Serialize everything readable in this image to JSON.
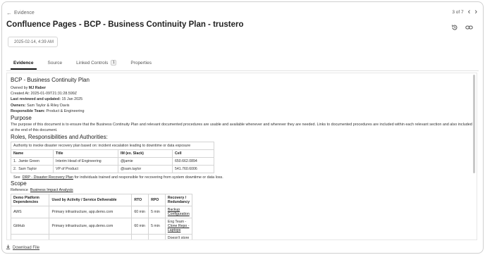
{
  "nav": {
    "back_label": "Evidence",
    "page_counter": "3 of 7"
  },
  "header": {
    "title": "Confluence Pages - BCP - Business Continuity Plan - trustero",
    "date": "2025-02-14, 4:39 AM"
  },
  "tabs": [
    {
      "label": "Evidence"
    },
    {
      "label": "Source"
    },
    {
      "label": "Linked Controls",
      "badge": "1"
    },
    {
      "label": "Properties"
    }
  ],
  "doc": {
    "title": "BCP - Business Continuity Plan",
    "owned_by_label": "Owned by",
    "owned_by": "MJ Raber",
    "created_at": "Created At: 2025-01-09T21:31:28.599Z",
    "last_reviewed_label": "Last reviewed and updated:",
    "last_reviewed": "15 Jan 2025",
    "owners_label": "Owners:",
    "owners": "Sam Taylor & Riley Davis",
    "team_label": "Responsible Team:",
    "team": "Product & Engineering",
    "purpose_heading": "Purpose",
    "purpose_text": "The purpose of this document is to ensure that the Business Continuity Plan and relevant documented procedures are usable and available whenever and wherever they are needed. Links to documented procedures are included within each relevant section and also included at the end of this document.",
    "roles_heading": "Roles, Responsibilities and Authorities:",
    "authority_text": "Authority to invoke disaster recovery plan based on: incident escalation leading to downtime or data exposure",
    "roles_columns": [
      "Name",
      "Title",
      "IM (ex. Slack)",
      "Cell"
    ],
    "roles_rows": [
      {
        "num": "1.",
        "name": "Jamie Green",
        "title": "Interim Head of Engineering",
        "im": "@jamie",
        "cell": "650.662.0894"
      },
      {
        "num": "2.",
        "name": "Sam Taylor",
        "title": "VP of Product",
        "im": "@sam.taylor",
        "cell": "541.760.6006"
      }
    ],
    "see_label": "See",
    "see_link": "DRP - Disaster Recovery Plan",
    "see_rest": "for individuals trained and responsible for recovering from system downtime or data loss.",
    "scope_heading": "Scope",
    "reference_label": "Reference",
    "reference_link": "Business Impact Analysis",
    "scope_columns": [
      "Demo Platform Dependencies",
      "Used by Activity / Service Deliverable",
      "RTO",
      "RPO",
      "Recovery / Redundancy"
    ],
    "scope_rows": [
      {
        "dep": "AWS",
        "used": "Primary infrastructure, app.demo.com",
        "rto": "60 min",
        "rpo": "5 min",
        "recovery_link": "Backup Configuration",
        "recovery_prefix": ""
      },
      {
        "dep": "GitHub",
        "used": "Primary infrastructure, app.demo.com",
        "rto": "60 min",
        "rpo": "5 min",
        "recovery_prefix": "Eng Team -",
        "recovery_link": "Clone Repo - Laptops"
      },
      {
        "dep": "",
        "used": "",
        "rto": "",
        "rpo": "",
        "recovery_prefix": "Doesn't store data",
        "recovery_link": ""
      }
    ]
  },
  "footer": {
    "download_label": "Download File"
  },
  "colors": {
    "text": "#222222",
    "border": "#d4d4d4",
    "muted": "#666666"
  },
  "icons": [
    "back-arrow-icon",
    "chevron-left-icon",
    "chevron-right-icon",
    "history-icon",
    "link-icon",
    "download-icon"
  ]
}
